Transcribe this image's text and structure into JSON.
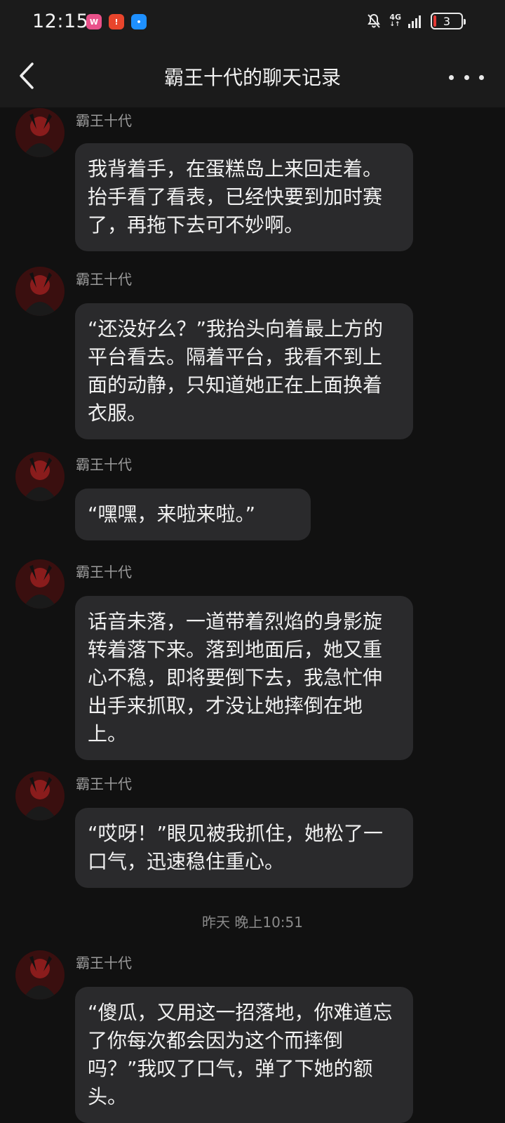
{
  "status_bar": {
    "time": "12:15",
    "network": "4G",
    "battery": "3",
    "icons": [
      "weibo-icon",
      "red-app-icon",
      "chat-app-icon",
      "mute-bell-icon",
      "signal-icon",
      "battery-icon"
    ]
  },
  "header": {
    "title": "霸王十代的聊天记录"
  },
  "messages": [
    {
      "sender": "霸王十代",
      "text": "我背着手，在蛋糕岛上来回走着。抬手看了看表，已经快要到加时赛了，再拖下去可不妙啊。"
    },
    {
      "sender": "霸王十代",
      "text": "“还没好么？”我抬头向着最上方的平台看去。隔着平台，我看不到上面的动静，只知道她正在上面换着衣服。"
    },
    {
      "sender": "霸王十代",
      "text": "“嘿嘿，来啦来啦。”"
    },
    {
      "sender": "霸王十代",
      "text": "话音未落，一道带着烈焰的身影旋转着落下来。落到地面后，她又重心不稳，即将要倒下去，我急忙伸出手来抓取，才没让她摔倒在地上。"
    },
    {
      "sender": "霸王十代",
      "text": "“哎呀！”眼见被我抓住，她松了一口气，迅速稳住重心。"
    },
    {
      "sender": "霸王十代",
      "text": "“傻瓜，又用这一招落地，你难道忘了你每次都会因为这个而摔倒吗？”我叹了口气，弹了下她的额头。"
    }
  ],
  "timestamp": "昨天 晚上10:51",
  "colors": {
    "background": "#111111",
    "header": "#1b1b1b",
    "bubble": "#2a2a2c",
    "text": "#f0f0f0",
    "meta_text": "#9a9a9a"
  }
}
